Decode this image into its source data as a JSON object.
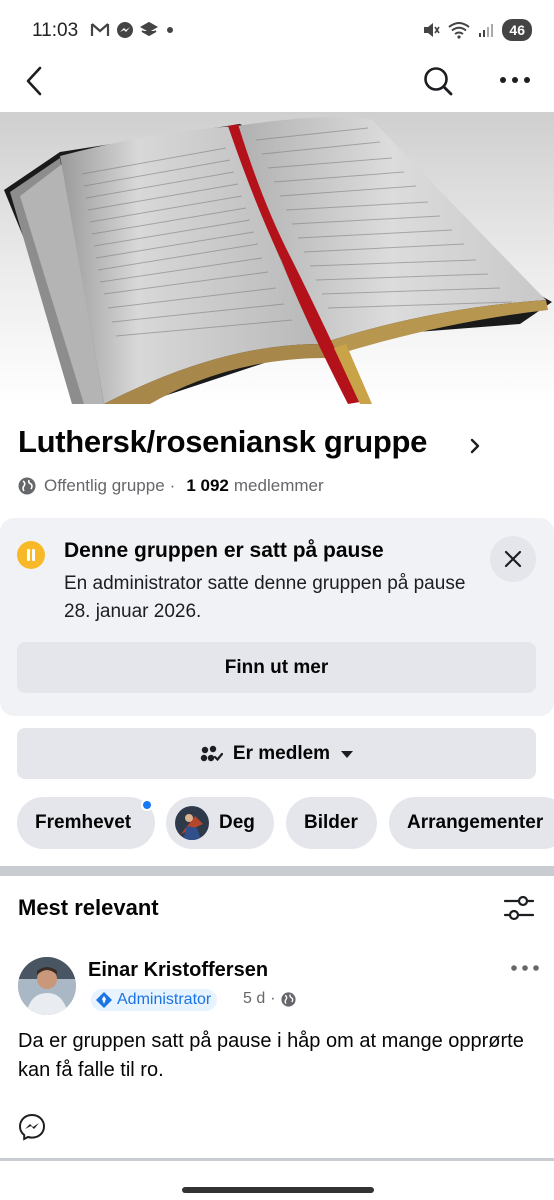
{
  "status_bar": {
    "time": "11:03",
    "battery": "46",
    "icons_left": [
      "gmail-icon",
      "messenger-icon",
      "layers-icon",
      "dot-icon"
    ],
    "icons_right": [
      "mute-icon",
      "wifi-icon",
      "signal-icon"
    ]
  },
  "nav": {
    "icons": [
      "back-icon",
      "search-icon",
      "more-icon"
    ]
  },
  "group": {
    "name": "Luthersk/roseniansk gruppe",
    "privacy": "Offentlig gruppe",
    "separator": "·",
    "member_count": "1 092",
    "members_label": "medlemmer"
  },
  "pause_notice": {
    "title": "Denne gruppen er satt på pause",
    "description": "En administrator satte denne gruppen på pause 28. januar 2026.",
    "button": "Finn ut mer"
  },
  "membership_button": "Er medlem",
  "chips": [
    {
      "label": "Fremhevet",
      "has_notification_dot": true
    },
    {
      "label": "Deg",
      "has_avatar": true
    },
    {
      "label": "Bilder"
    },
    {
      "label": "Arrangementer"
    }
  ],
  "feed": {
    "sort_label": "Mest relevant"
  },
  "post": {
    "author": "Einar Kristoffersen",
    "role_badge": "Administrator",
    "time": "5 d",
    "text": "Da er gruppen satt på pause i håp om at mange opprørte kan få falle til ro."
  },
  "colors": {
    "accent": "#1877f2",
    "pause_yellow": "#f7b928",
    "chip_bg": "#e4e6eb",
    "card_bg": "#f0f2f5",
    "muted_text": "#65676b"
  }
}
